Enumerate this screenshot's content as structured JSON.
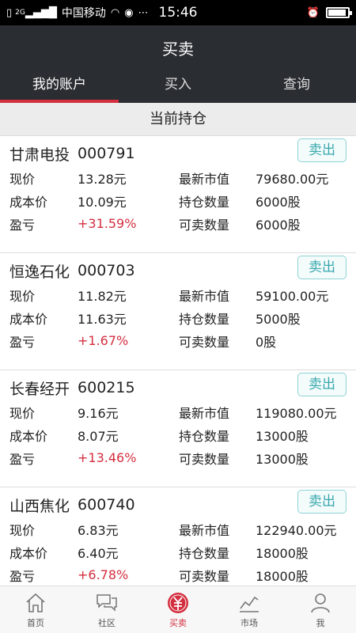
{
  "status": {
    "carrier": "中国移动",
    "time": "15:46",
    "network": "2G",
    "battery_level": 0.9
  },
  "header": {
    "title": "买卖",
    "tabs": [
      {
        "label": "我的账户",
        "active": true
      },
      {
        "label": "买入",
        "active": false
      },
      {
        "label": "查询",
        "active": false
      }
    ]
  },
  "section_title": "当前持仓",
  "labels": {
    "price": "现价",
    "cost": "成本价",
    "pnl": "盈亏",
    "market_value": "最新市值",
    "holding": "持仓数量",
    "sellable": "可卖数量",
    "sell_button": "卖出"
  },
  "positions": [
    {
      "name": "甘肃电投",
      "code": "000791",
      "price": "13.28元",
      "cost": "10.09元",
      "pnl": "+31.59%",
      "market_value": "79680.00元",
      "holding": "6000股",
      "sellable": "6000股"
    },
    {
      "name": "恒逸石化",
      "code": "000703",
      "price": "11.82元",
      "cost": "11.63元",
      "pnl": "+1.67%",
      "market_value": "59100.00元",
      "holding": "5000股",
      "sellable": "0股"
    },
    {
      "name": "长春经开",
      "code": "600215",
      "price": "9.16元",
      "cost": "8.07元",
      "pnl": "+13.46%",
      "market_value": "119080.00元",
      "holding": "13000股",
      "sellable": "13000股"
    },
    {
      "name": "山西焦化",
      "code": "600740",
      "price": "6.83元",
      "cost": "6.40元",
      "pnl": "+6.78%",
      "market_value": "122940.00元",
      "holding": "18000股",
      "sellable": "18000股"
    }
  ],
  "bottom_nav": [
    {
      "label": "首页",
      "icon": "home-icon",
      "active": false
    },
    {
      "label": "社区",
      "icon": "chat-icon",
      "active": false
    },
    {
      "label": "买卖",
      "icon": "yuan-icon",
      "active": true
    },
    {
      "label": "市场",
      "icon": "chart-icon",
      "active": false
    },
    {
      "label": "我",
      "icon": "user-icon",
      "active": false
    }
  ],
  "colors": {
    "accent": "#d32f3f",
    "header_bg": "#2a2d31",
    "sell_button": "#39a8ad"
  }
}
